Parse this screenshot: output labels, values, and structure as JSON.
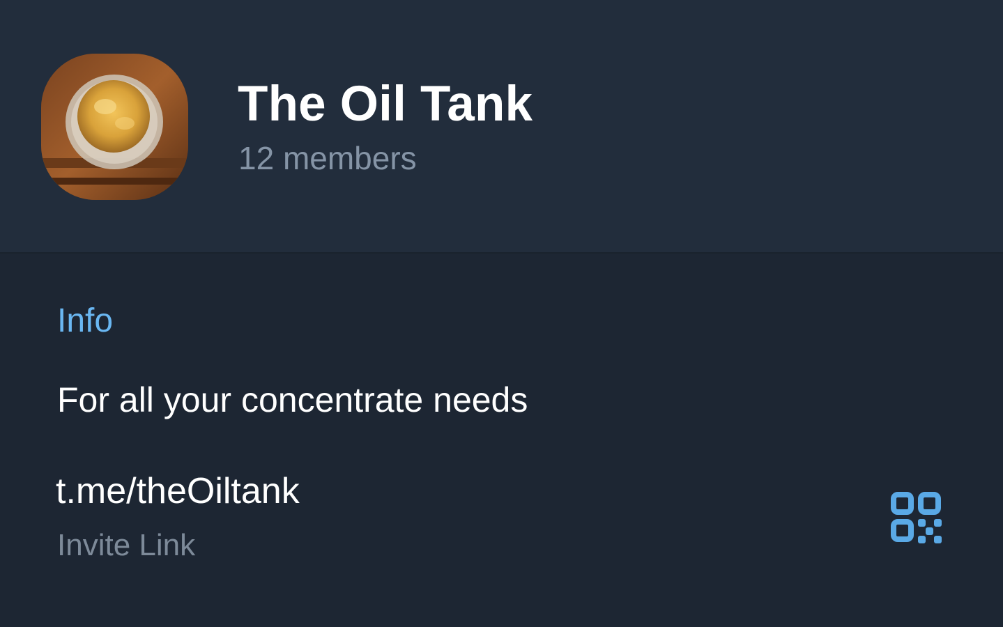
{
  "header": {
    "title": "The Oil Tank",
    "members": "12 members",
    "avatar_icon": "group-photo-avatar"
  },
  "info": {
    "section_title": "Info",
    "description": "For all your concentrate needs",
    "invite_link": {
      "value": "t.me/theOiltank",
      "caption": "Invite Link",
      "action_icon": "qr-code-icon"
    }
  },
  "colors": {
    "header_bg": "#222d3c",
    "body_bg": "#1d2633",
    "accent": "#6ab7f2",
    "secondary_text": "#8594a6"
  }
}
